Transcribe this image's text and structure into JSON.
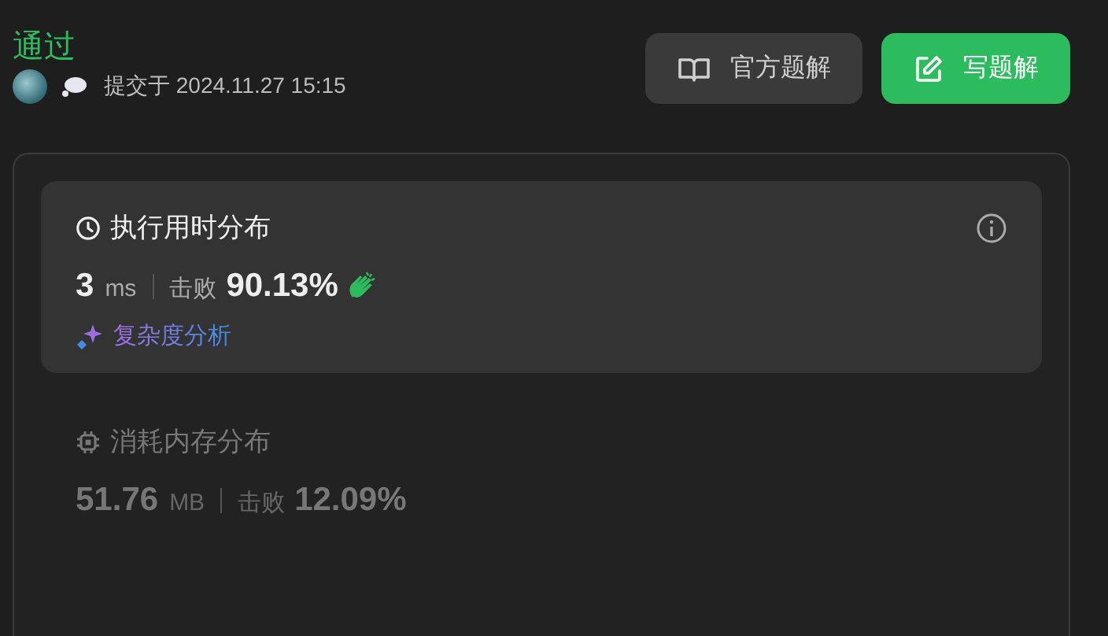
{
  "header": {
    "status": "通过",
    "submitted": "提交于 2024.11.27 15:15"
  },
  "buttons": [
    {
      "kind": "book",
      "label": "官方题解",
      "primary": false
    },
    {
      "kind": "edit",
      "label": "写题解",
      "primary": true
    }
  ],
  "stats": [
    {
      "kind": "runtime",
      "title": "执行用时分布",
      "selected": true,
      "value": "3",
      "unit": "ms",
      "beats_label": "击败",
      "beats": "90.13%",
      "analysis_link": "复杂度分析"
    },
    {
      "kind": "memory",
      "title": "消耗内存分布",
      "selected": false,
      "value": "51.76",
      "unit": "MB",
      "beats_label": "击败",
      "beats": "12.09%"
    }
  ]
}
